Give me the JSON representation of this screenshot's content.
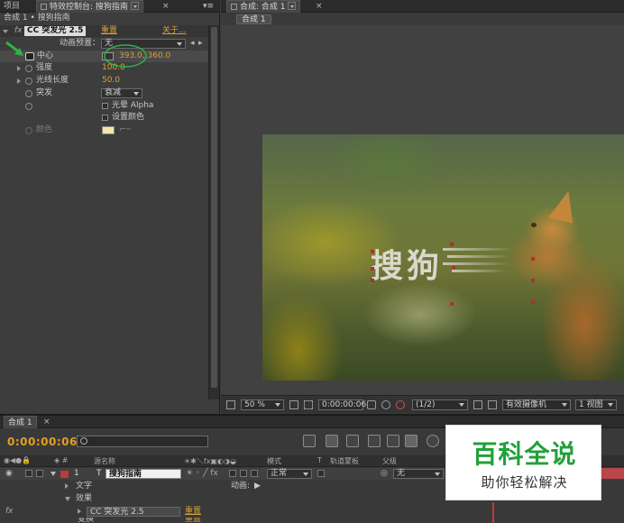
{
  "left_panel": {
    "tabs": [
      "项目",
      "特效控制台: 搜狗指南"
    ],
    "breadcrumb": "合成 1 • 搜狗指南",
    "effect": {
      "fx_label": "fx",
      "name": "CC 突发光 2.5",
      "reset_label": "重置",
      "about_label": "关于...",
      "preset_label": "动画预置：",
      "preset_value": "无"
    },
    "properties": [
      {
        "label": "中心",
        "value": "393.0, 360.0"
      },
      {
        "label": "强度",
        "value": "100.0"
      },
      {
        "label": "光线长度",
        "value": "50.0"
      },
      {
        "label": "突发",
        "value": "衰减"
      },
      {
        "label": "光晕 Alpha"
      },
      {
        "label": "设置颜色"
      },
      {
        "label": "颜色",
        "color": "#f5e6a8"
      }
    ]
  },
  "viewer": {
    "tab": "合成: 合成 1",
    "sub_tab": "合成 1",
    "composition_text": "搜狗",
    "toolbar": {
      "zoom": "50 %",
      "timecode": "0:00:00:06",
      "resolution": "(1/2)",
      "camera": "有效摄像机",
      "views": "1 视图"
    }
  },
  "timeline": {
    "tab": "合成 1",
    "current_time": "0:00:00:06",
    "columns": {
      "source_name": "源名称",
      "mode": "模式",
      "track_matte": "轨道蒙板",
      "parent": "父级"
    },
    "layer": {
      "index": "1",
      "type": "T",
      "name": "搜狗指南",
      "mode": "正常",
      "parent": "无",
      "label_color": "#c03a3a"
    },
    "groups": [
      "文字",
      "效果"
    ],
    "animate_label": "动画:",
    "effect_row": {
      "name": "CC 突发光 2.5",
      "reset_label": "重置"
    },
    "last_row_label": "变换",
    "last_row_action": "重置"
  },
  "watermark": {
    "title": "百科全说",
    "subtitle": "助你轻松解决"
  },
  "colors": {
    "accent_orange": "#d4a23a",
    "annotation_green": "#2db34a"
  }
}
